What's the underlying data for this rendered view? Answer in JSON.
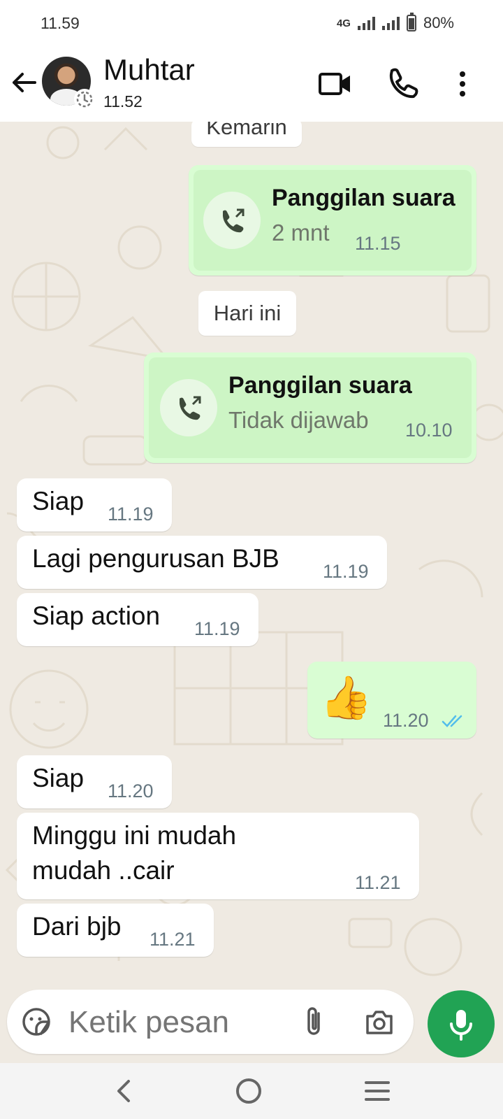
{
  "status_bar": {
    "time": "11.59",
    "network": "4G",
    "battery": "80%"
  },
  "header": {
    "name": "Muhtar",
    "status": "11.52"
  },
  "date_chips": {
    "yesterday": "Kemarin",
    "today": "Hari ini"
  },
  "messages": [
    {
      "id": "call1",
      "direction": "outgoing",
      "type": "voice-call",
      "title": "Panggilan suara",
      "detail": "2 mnt",
      "time": "11.15"
    },
    {
      "id": "call2",
      "direction": "outgoing",
      "type": "voice-call",
      "title": "Panggilan suara",
      "detail": "Tidak dijawab",
      "time": "10.10"
    },
    {
      "id": "m1",
      "direction": "incoming",
      "text": "Siap",
      "time": "11.19"
    },
    {
      "id": "m2",
      "direction": "incoming",
      "text": "Lagi pengurusan BJB",
      "time": "11.19"
    },
    {
      "id": "m3",
      "direction": "incoming",
      "text": "Siap action",
      "time": "11.19"
    },
    {
      "id": "m4",
      "direction": "outgoing",
      "emoji": "👍",
      "time": "11.20",
      "read": true
    },
    {
      "id": "m5",
      "direction": "incoming",
      "text": "Siap",
      "time": "11.20"
    },
    {
      "id": "m6",
      "direction": "incoming",
      "line1": "Minggu ini mudah",
      "line2": "mudah ..cair",
      "time": "11.21"
    },
    {
      "id": "m7",
      "direction": "incoming",
      "text": "Dari bjb",
      "time": "11.21"
    }
  ],
  "composer": {
    "placeholder": "Ketik pesan"
  },
  "colors": {
    "outgoing_bubble": "#d9fdd3",
    "incoming_bubble": "#ffffff",
    "chat_background": "#efeae2",
    "accent_green": "#21a354",
    "read_ticks": "#53bdeb"
  },
  "icons": [
    "back-arrow-icon",
    "disappearing-timer-icon",
    "video-call-icon",
    "voice-call-icon",
    "more-options-icon",
    "call-outgoing-icon",
    "double-check-icon",
    "sticker-icon",
    "attach-icon",
    "camera-icon",
    "mic-icon",
    "nav-back-icon",
    "nav-home-icon",
    "nav-recents-icon"
  ]
}
